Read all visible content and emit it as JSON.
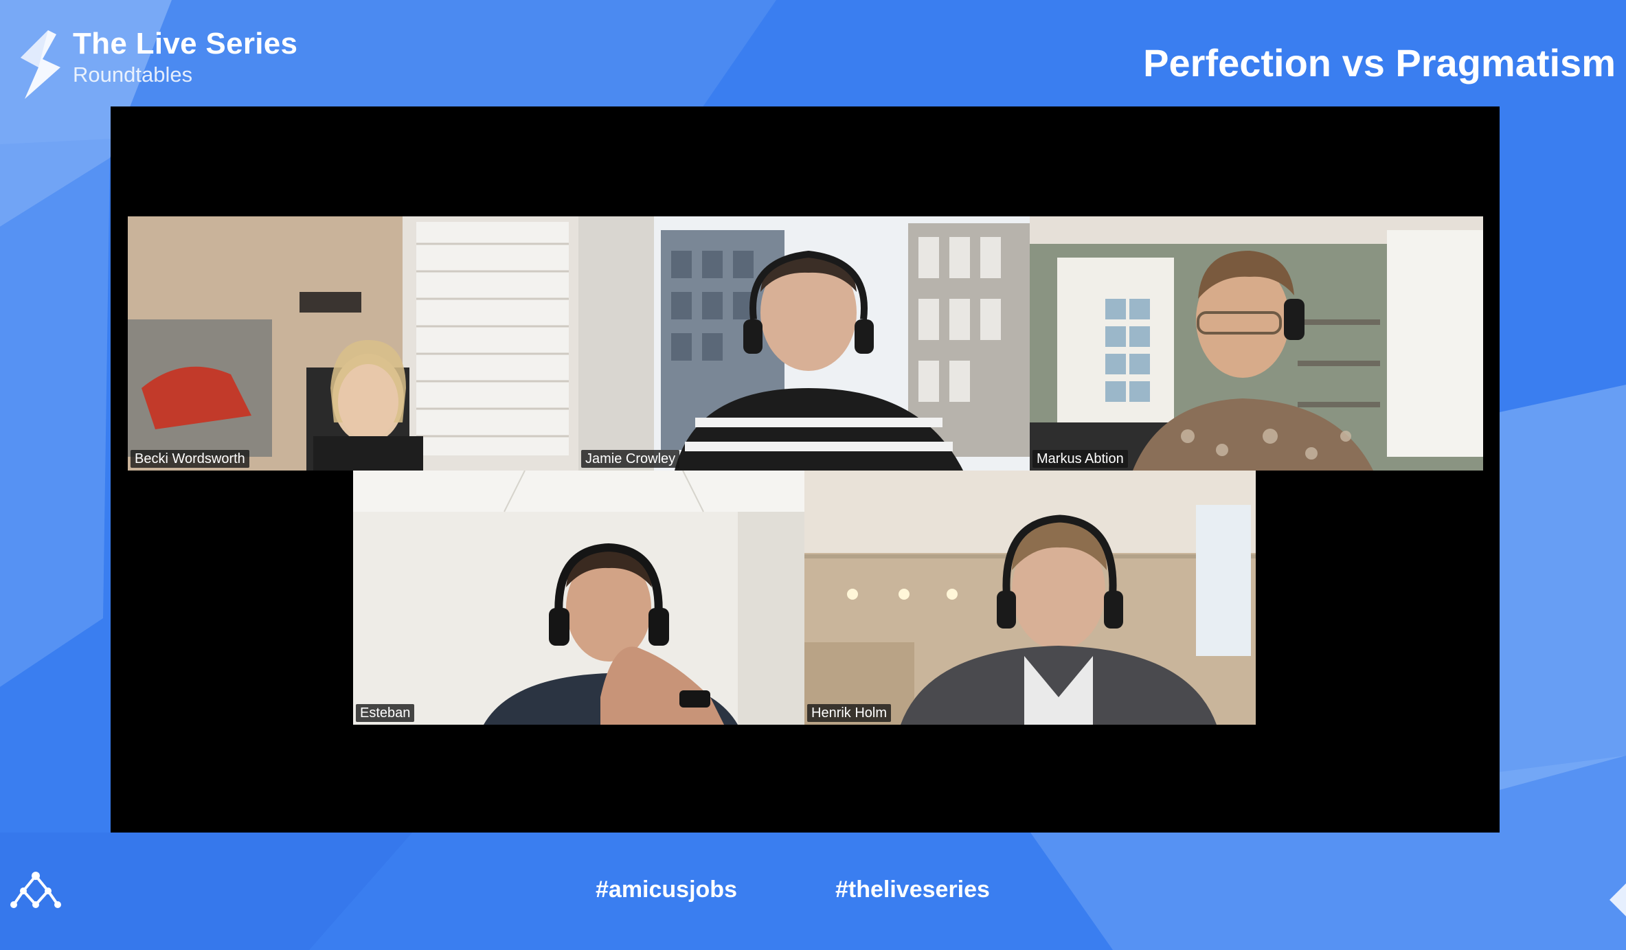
{
  "brand": {
    "title": "The Live Series",
    "subtitle": "Roundtables",
    "logo_icon": "series-logo-icon"
  },
  "episode": {
    "title": "Perfection vs Pragmatism"
  },
  "participants": [
    {
      "name": "Becki Wordsworth"
    },
    {
      "name": "Jamie Crowley"
    },
    {
      "name": "Markus Abtion"
    },
    {
      "name": "Esteban"
    },
    {
      "name": "Henrik Holm"
    }
  ],
  "hashtags": [
    "#amicusjobs",
    "#theliveseries"
  ],
  "footer": {
    "logo_icon": "network-logo-icon"
  },
  "colors": {
    "background": "#3a7ef0",
    "stage": "#000000",
    "text": "#ffffff"
  }
}
